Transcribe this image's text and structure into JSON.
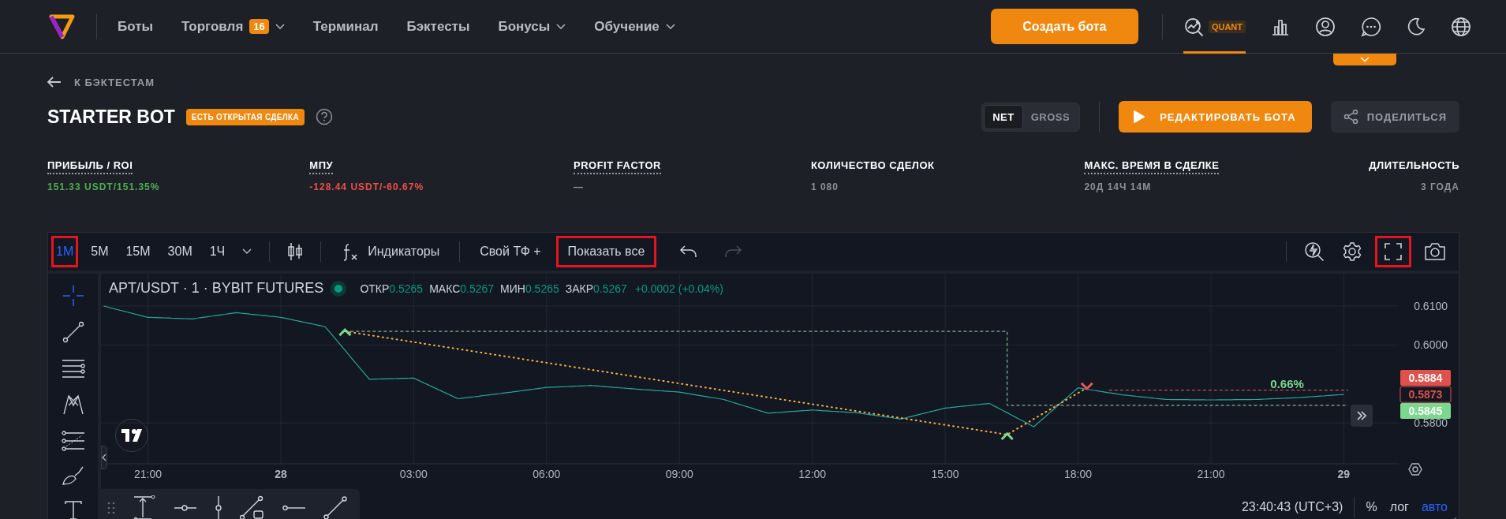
{
  "nav": {
    "links": [
      {
        "label": "Боты",
        "dropdown": false
      },
      {
        "label": "Торговля",
        "badge": "16",
        "dropdown": true
      },
      {
        "label": "Терминал",
        "dropdown": false
      },
      {
        "label": "Бэктесты",
        "dropdown": false
      },
      {
        "label": "Бонусы",
        "dropdown": true
      },
      {
        "label": "Обучение",
        "dropdown": true
      }
    ],
    "create_button": "Создать бота",
    "quant": {
      "badge": "QUANT",
      "selected": true
    }
  },
  "back_link": "К БЭКТЕСТАМ",
  "title": "STARTER BOT",
  "status_badge": "ЕСТЬ ОТКРЫТАЯ СДЕЛКА",
  "mode_toggle": [
    {
      "label": "NET",
      "selected": true
    },
    {
      "label": "GROSS",
      "selected": false
    }
  ],
  "edit_button": "РЕДАКТИРОВАТЬ БОТА",
  "share_button": "ПОДЕЛИТЬСЯ",
  "stats": [
    {
      "label": "ПРИБЫЛЬ / ROI",
      "value": "151.33 USDT/151.35%",
      "color": "#4caf50",
      "tooltip": true
    },
    {
      "label": "МПУ",
      "value": "-128.44 USDT/-60.67%",
      "color": "#ef4f4a",
      "tooltip": true
    },
    {
      "label": "PROFIT FACTOR",
      "value": "—",
      "color": "#8d9099",
      "tooltip": true
    },
    {
      "label": "КОЛИЧЕСТВО СДЕЛОК",
      "value": "1 080",
      "color": "#8d9099",
      "tooltip": false
    },
    {
      "label": "МАКС. ВРЕМЯ В СДЕЛКЕ",
      "value": "20Д 14Ч 14М",
      "color": "#8d9099",
      "tooltip": true
    },
    {
      "label": "ДЛИТЕЛЬНОСТЬ",
      "value": "3 ГОДА",
      "color": "#8d9099",
      "tooltip": false
    }
  ],
  "chart": {
    "timeframes": [
      {
        "label": "1М",
        "selected": true,
        "highlighted": true
      },
      {
        "label": "5М",
        "selected": false,
        "highlighted": false
      },
      {
        "label": "15М",
        "selected": false,
        "highlighted": false
      },
      {
        "label": "30М",
        "selected": false,
        "highlighted": false
      },
      {
        "label": "1Ч",
        "selected": false,
        "highlighted": false
      }
    ],
    "indicators_button": "Индикаторы",
    "custom_tf_button": "Свой ТФ +",
    "show_all": {
      "label": "Показать все",
      "highlighted": true
    },
    "redo_disabled": true,
    "fullscreen_highlighted": true,
    "symbol": "APT/USDT · 1 · BYBIT FUTURES",
    "ohlc": [
      {
        "label": "ОТКР",
        "value": "0.5265"
      },
      {
        "label": "МАКС",
        "value": "0.5267"
      },
      {
        "label": "МИН",
        "value": "0.5265"
      },
      {
        "label": "ЗАКР",
        "value": "0.5267"
      }
    ],
    "change": "+0.0002 (+0.04%)",
    "chart_data": {
      "type": "line",
      "grid": true,
      "categories": [
        null,
        "21:00",
        null,
        null,
        "28",
        null,
        null,
        "03:00",
        null,
        null,
        "06:00",
        null,
        null,
        "09:00",
        null,
        null,
        "12:00",
        null,
        null,
        "15:00",
        null,
        null,
        "18:00",
        null,
        null,
        "21:00",
        null,
        null,
        "29"
      ],
      "series": [
        {
          "color": "#26a69a",
          "values": [
            0.61,
            0.6071,
            0.6067,
            0.6083,
            0.6071,
            0.6047,
            0.5912,
            0.5915,
            0.5862,
            0.5876,
            0.5891,
            0.5896,
            0.5887,
            0.5879,
            0.586,
            0.5825,
            0.5833,
            0.5826,
            0.581,
            0.5838,
            0.585,
            0.579,
            0.589,
            0.5872,
            0.586,
            0.5859,
            0.586,
            0.5865,
            0.5873
          ]
        }
      ],
      "ylim": [
        0.5695,
        0.6183
      ],
      "yticks": [
        {
          "value": 0.58,
          "label": "0.5800"
        },
        {
          "value": 0.6,
          "label": "0.6000"
        },
        {
          "value": 0.61,
          "label": "0.6100"
        }
      ]
    },
    "price_tags": [
      {
        "text": "0.5884",
        "kind": "sell"
      },
      {
        "text": "0.5873",
        "kind": "last"
      },
      {
        "text": "0.5845",
        "kind": "buy"
      }
    ],
    "profit_label": "0.66%",
    "clock": "23:40:43 (UTC+3)",
    "scale_options": [
      {
        "label": "%",
        "selected": false
      },
      {
        "label": "лог",
        "selected": false
      },
      {
        "label": "авто",
        "selected": true
      }
    ]
  }
}
